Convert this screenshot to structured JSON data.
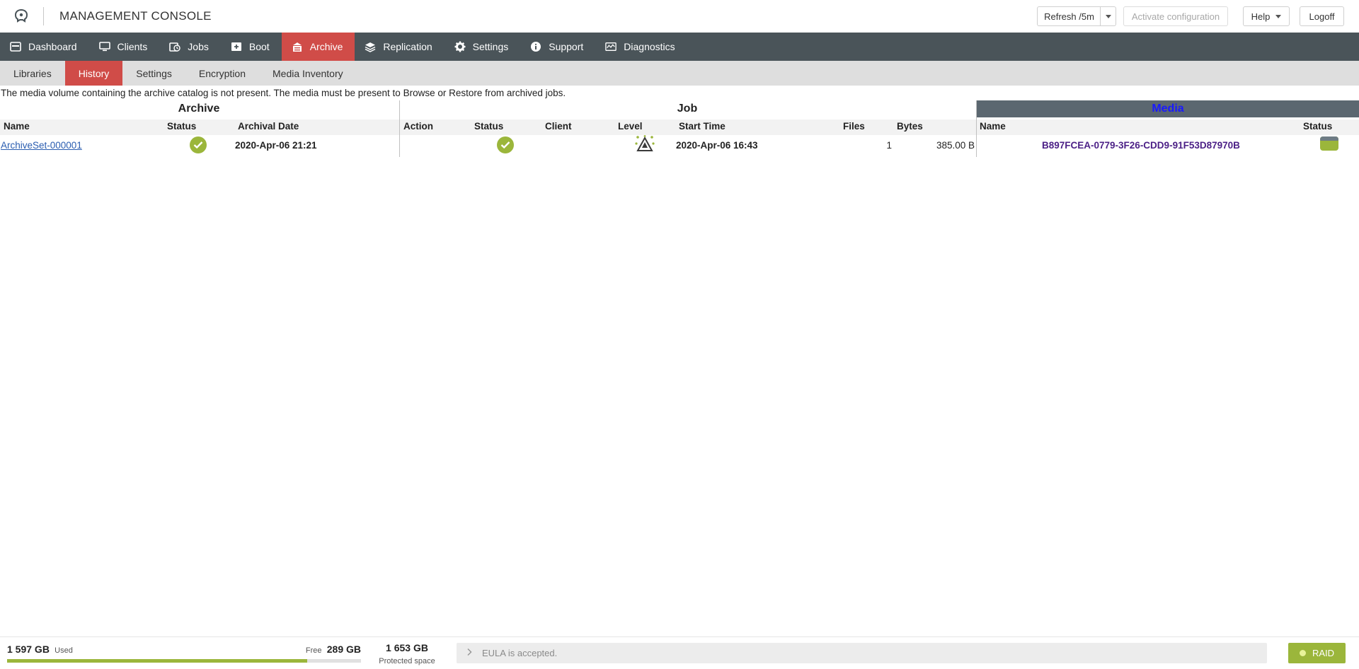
{
  "header": {
    "title": "MANAGEMENT CONSOLE",
    "refresh_label": "Refresh /5m",
    "activate_label": "Activate configuration",
    "help_label": "Help",
    "logoff_label": "Logoff"
  },
  "main_nav": [
    {
      "label": "Dashboard",
      "icon": "dashboard-icon"
    },
    {
      "label": "Clients",
      "icon": "monitor-icon"
    },
    {
      "label": "Jobs",
      "icon": "jobs-icon"
    },
    {
      "label": "Boot",
      "icon": "boot-icon"
    },
    {
      "label": "Archive",
      "icon": "archive-icon",
      "active": true
    },
    {
      "label": "Replication",
      "icon": "layers-icon"
    },
    {
      "label": "Settings",
      "icon": "gear-icon"
    },
    {
      "label": "Support",
      "icon": "info-icon"
    },
    {
      "label": "Diagnostics",
      "icon": "chart-icon"
    }
  ],
  "sub_nav": [
    {
      "label": "Libraries"
    },
    {
      "label": "History",
      "active": true
    },
    {
      "label": "Settings"
    },
    {
      "label": "Encryption"
    },
    {
      "label": "Media Inventory"
    }
  ],
  "notice": "The media volume containing the archive catalog is not present. The media must be present to Browse or Restore from archived jobs.",
  "table": {
    "groups": {
      "archive": "Archive",
      "job": "Job",
      "media": "Media"
    },
    "headers": {
      "archive_name": "Name",
      "archive_status": "Status",
      "archival_date": "Archival Date",
      "action": "Action",
      "job_status": "Status",
      "client": "Client",
      "level": "Level",
      "start_time": "Start Time",
      "files": "Files",
      "bytes": "Bytes",
      "media_name": "Name",
      "media_status": "Status"
    },
    "rows": [
      {
        "archive_name": "ArchiveSet-000001",
        "archive_status": "ok",
        "archival_date": "2020-Apr-06 21:21",
        "action": "",
        "job_status": "ok",
        "client": "",
        "level": "level-icon",
        "start_time": "2020-Apr-06 16:43",
        "files": "1",
        "bytes": "385.00 B",
        "media_name": "B897FCEA-0779-3F26-CDD9-91F53D87970B",
        "media_status": "disk-icon"
      }
    ]
  },
  "footer": {
    "used_value": "1 597 GB",
    "used_label": "Used",
    "free_label": "Free",
    "free_value": "289 GB",
    "used_fraction": 0.847,
    "protected_value": "1 653 GB",
    "protected_label": "Protected space",
    "eula_text": "EULA is accepted.",
    "raid_label": "RAID"
  },
  "colors": {
    "nav_bg": "#4a5459",
    "accent": "#d04c48",
    "ok_green": "#9bb63b",
    "media_header_bg": "#5b6770"
  }
}
